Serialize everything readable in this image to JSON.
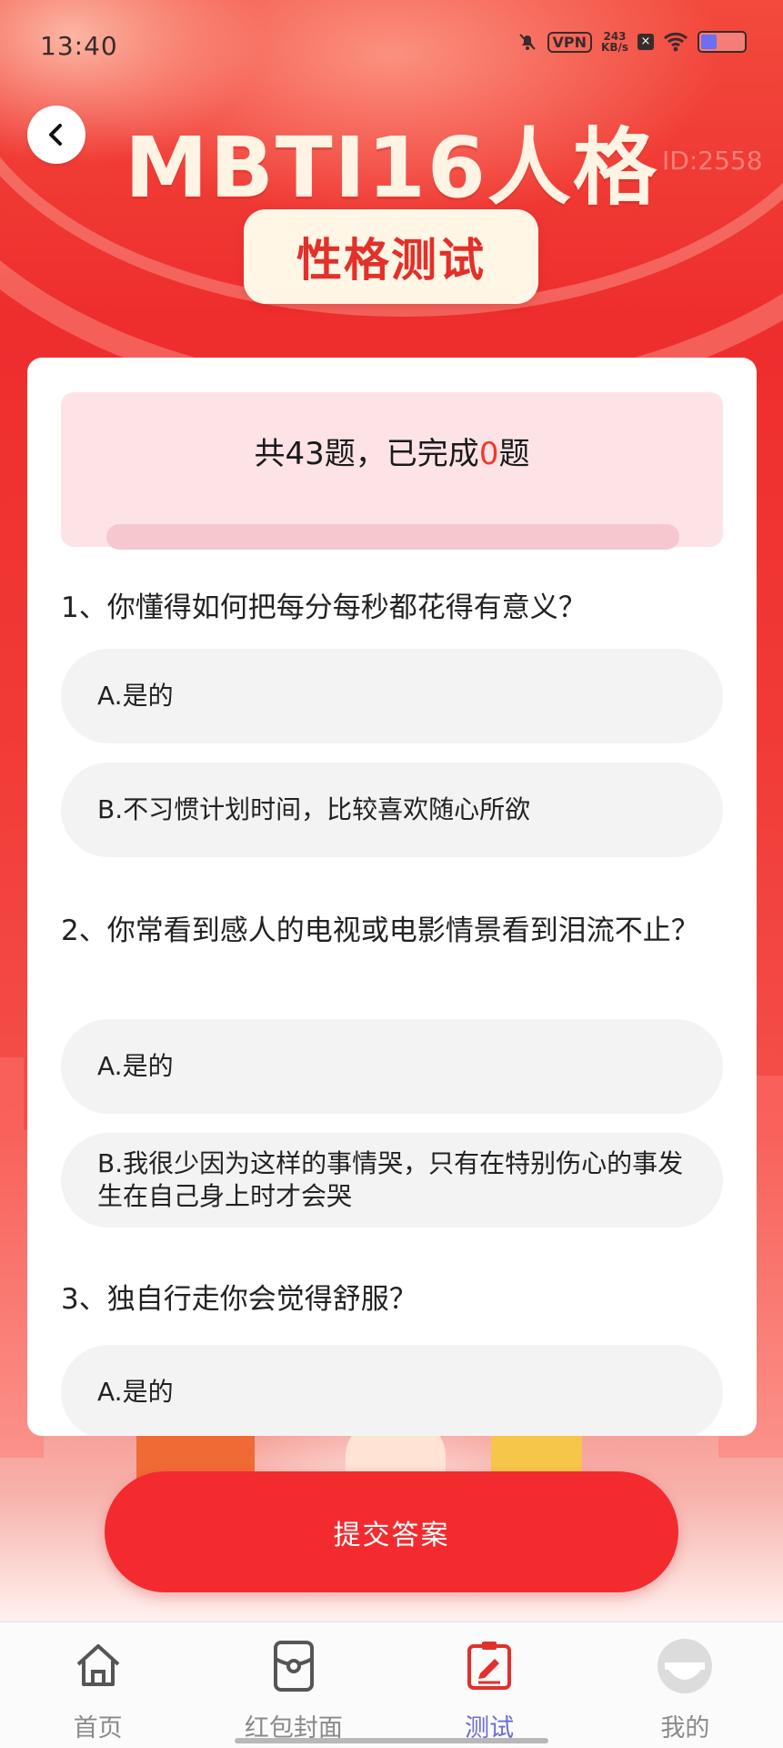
{
  "status_bar": {
    "time": "13:40",
    "vpn": "VPN",
    "speed_value": "243",
    "speed_unit": "KB/s",
    "battery_level": 0.33
  },
  "header": {
    "back_icon": "chevron-left-icon",
    "title": "MBTI16人格",
    "subtitle": "性格测试",
    "watermark": "ID:2558"
  },
  "progress": {
    "prefix": "共43题，已完成",
    "completed": "0",
    "suffix": "题",
    "total": 43,
    "fraction": 0
  },
  "questions": [
    {
      "text": "1、你懂得如何把每分每秒都花得有意义？",
      "options": [
        "A.是的",
        "B.不习惯计划时间，比较喜欢随心所欲"
      ]
    },
    {
      "text": "2、你常看到感人的电视或电影情景看到泪流不止？",
      "options": [
        "A.是的",
        "B.我很少因为这样的事情哭，只有在特别伤心的事发生在自己身上时才会哭"
      ]
    },
    {
      "text": "3、独自行走你会觉得舒服？",
      "options": [
        "A.是的"
      ]
    }
  ],
  "submit_label": "提交答案",
  "tabs": [
    {
      "label": "首页",
      "icon": "home-icon",
      "active": false
    },
    {
      "label": "红包封面",
      "icon": "envelope-icon",
      "active": false
    },
    {
      "label": "测试",
      "icon": "test-edit-icon",
      "active": true
    },
    {
      "label": "我的",
      "icon": "avatar-icon",
      "active": false
    }
  ],
  "colors": {
    "accent": "#f32b2f",
    "active_tab": "#6b6bd6",
    "title": "#fff3e4"
  }
}
